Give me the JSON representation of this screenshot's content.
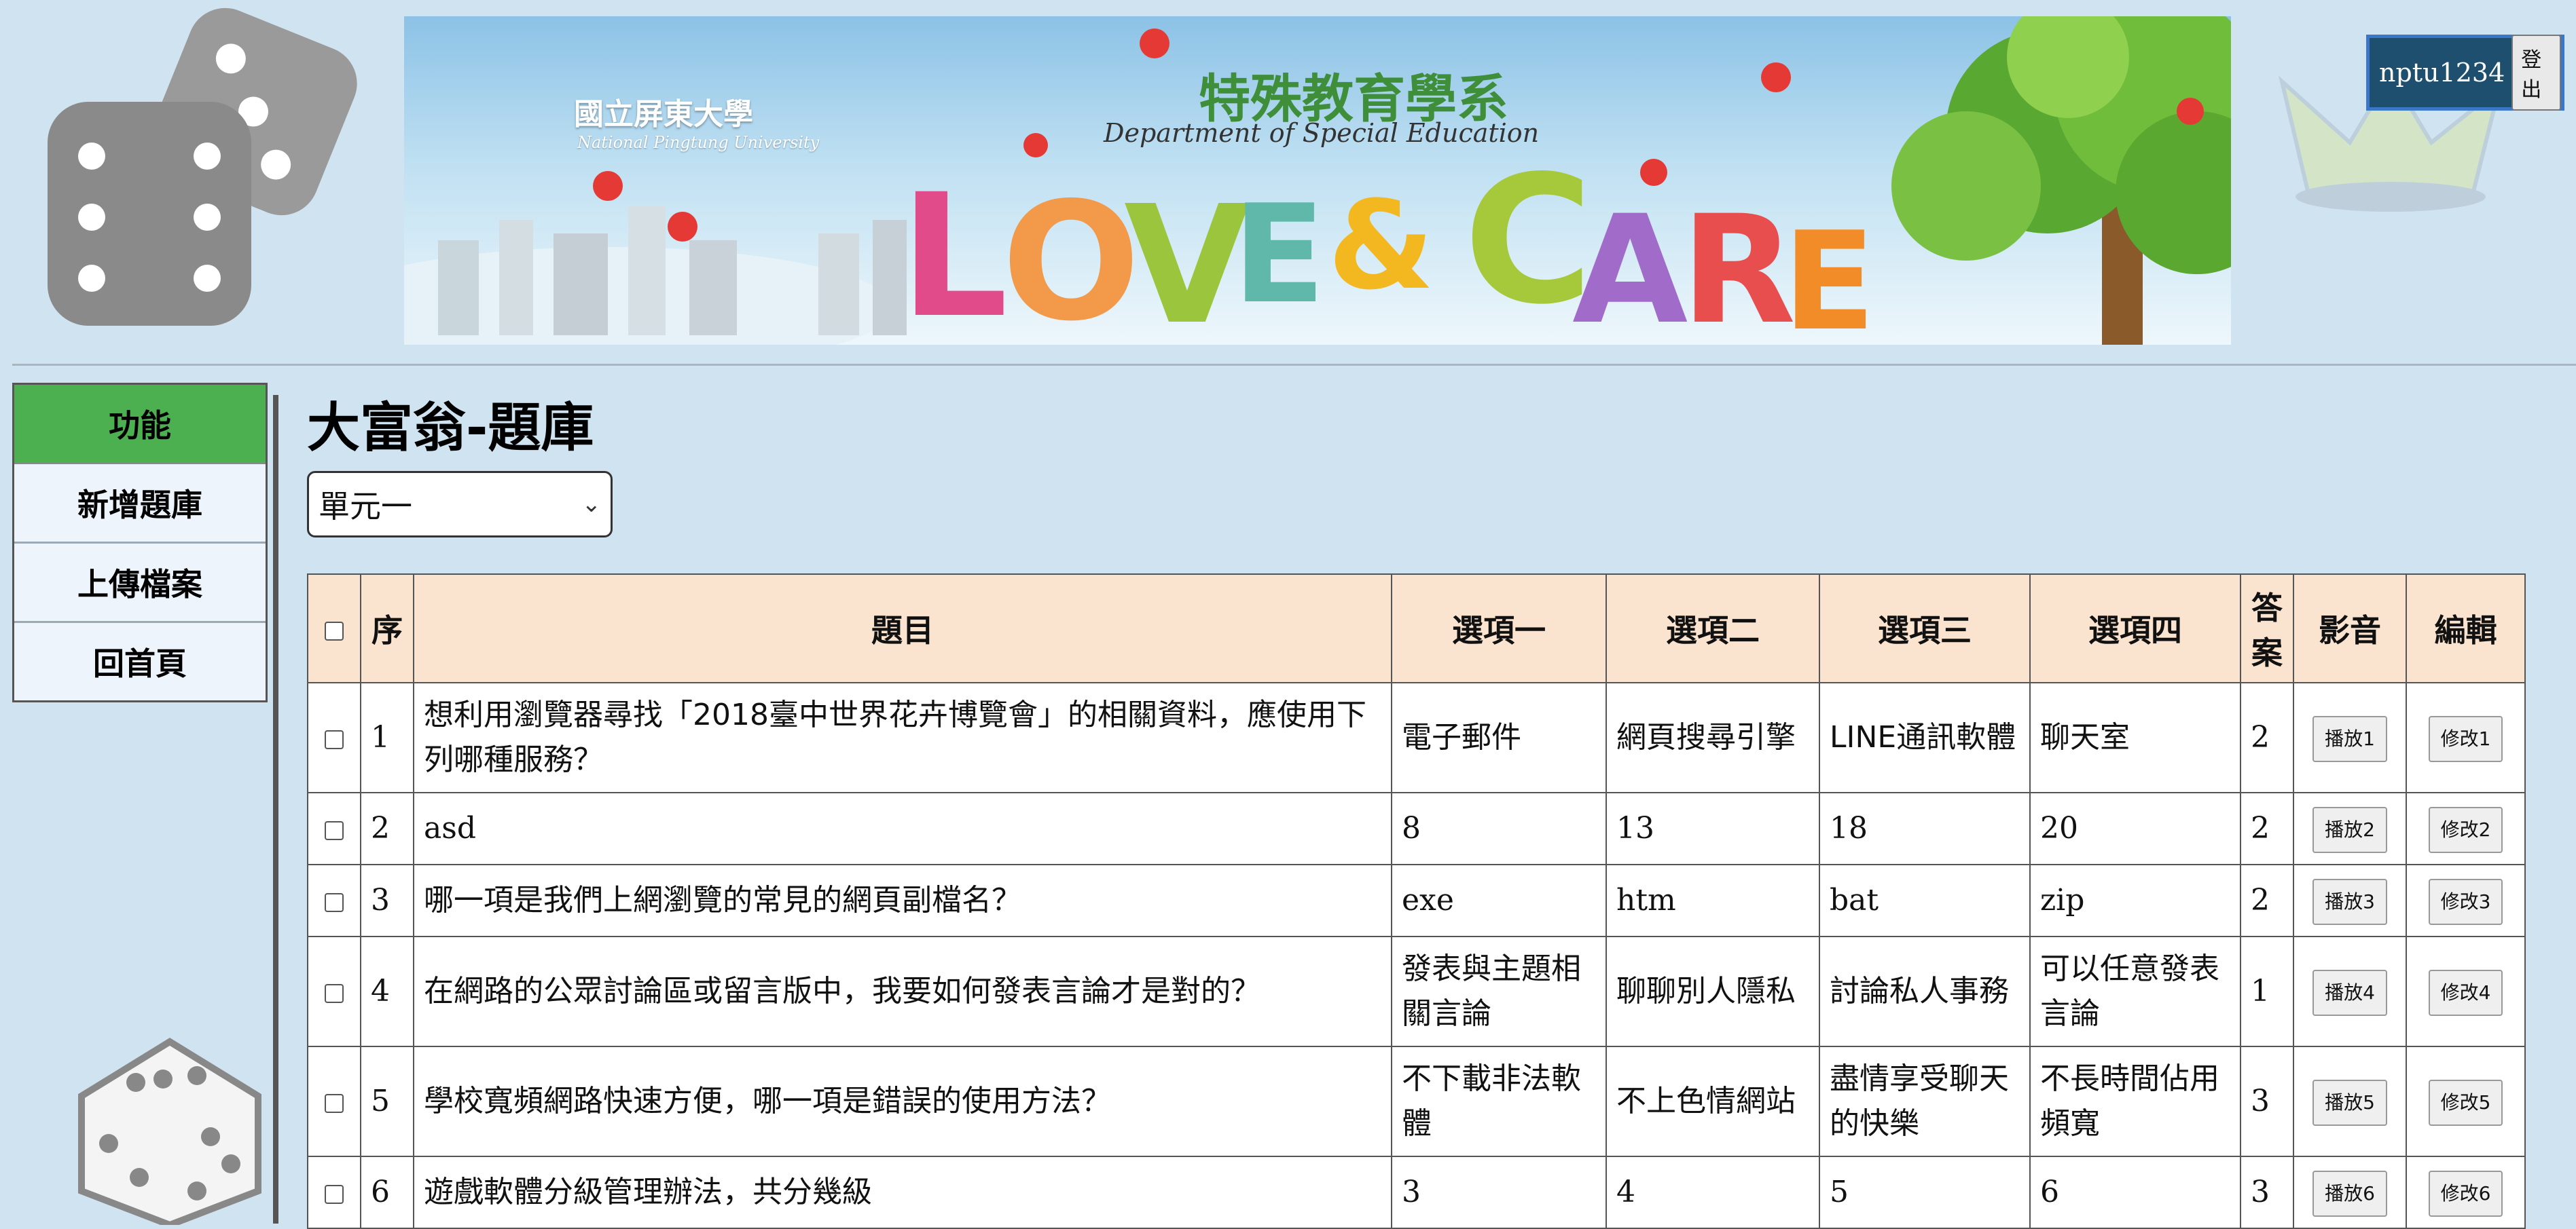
{
  "banner": {
    "university_zh": "國立屏東大學",
    "university_en": "National Pingtung University",
    "dept_zh": "特殊教育學系",
    "dept_en": "Department of Special Education",
    "slogan": "LOVE & CARE"
  },
  "user": {
    "username": "nptu1234",
    "logout_label": "登出"
  },
  "side_menu": {
    "header": "功能",
    "items": [
      {
        "label": "新增題庫"
      },
      {
        "label": "上傳檔案"
      },
      {
        "label": "回首頁"
      }
    ]
  },
  "page": {
    "title": "大富翁-題庫"
  },
  "unit_select": {
    "selected": "單元一"
  },
  "table": {
    "headers": {
      "index": "序",
      "question": "題目",
      "opt1": "選項一",
      "opt2": "選項二",
      "opt3": "選項三",
      "opt4": "選項四",
      "answer": "答案",
      "media": "影音",
      "edit": "編輯"
    },
    "rows": [
      {
        "no": "1",
        "question": "想利用瀏覽器尋找「2018臺中世界花卉博覽會」的相關資料，應使用下列哪種服務？",
        "opt1": "電子郵件",
        "opt2": "網頁搜尋引擎",
        "opt3": "LINE通訊軟體",
        "opt4": "聊天室",
        "answer": "2",
        "play": "播放1",
        "edit": "修改1"
      },
      {
        "no": "2",
        "question": "asd",
        "opt1": "8",
        "opt2": "13",
        "opt3": "18",
        "opt4": "20",
        "answer": "2",
        "play": "播放2",
        "edit": "修改2"
      },
      {
        "no": "3",
        "question": "哪一項是我們上網瀏覽的常見的網頁副檔名？",
        "opt1": "exe",
        "opt2": "htm",
        "opt3": "bat",
        "opt4": "zip",
        "answer": "2",
        "play": "播放3",
        "edit": "修改3"
      },
      {
        "no": "4",
        "question": "在網路的公眾討論區或留言版中，我要如何發表言論才是對的？",
        "opt1": "發表與主題相關言論",
        "opt2": "聊聊別人隱私",
        "opt3": "討論私人事務",
        "opt4": "可以任意發表言論",
        "answer": "1",
        "play": "播放4",
        "edit": "修改4"
      },
      {
        "no": "5",
        "question": "學校寬頻網路快速方便，哪一項是錯誤的使用方法？",
        "opt1": "不下載非法軟體",
        "opt2": "不上色情網站",
        "opt3": "盡情享受聊天的快樂",
        "opt4": "不長時間佔用頻寬",
        "answer": "3",
        "play": "播放5",
        "edit": "修改5"
      },
      {
        "no": "6",
        "question": "遊戲軟體分級管理辦法，共分幾級",
        "opt1": "3",
        "opt2": "4",
        "opt3": "5",
        "opt4": "6",
        "answer": "3",
        "play": "播放6",
        "edit": "修改6"
      }
    ]
  }
}
